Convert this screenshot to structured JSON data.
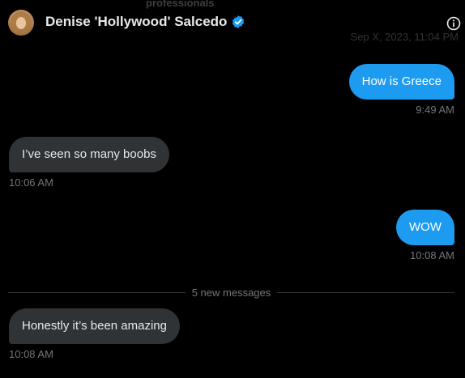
{
  "header": {
    "contact_name": "Denise 'Hollywood' Salcedo",
    "ghost_text": "professionals",
    "ghost_date": "Sep X, 2023, 11:04 PM",
    "icons": {
      "avatar": "avatar",
      "verified": "verified-badge-icon",
      "info": "info-icon"
    }
  },
  "messages": [
    {
      "direction": "out",
      "text": "How is Greece",
      "time": "9:49 AM"
    },
    {
      "direction": "in",
      "text": "I’ve seen so many boobs",
      "time": "10:06 AM"
    },
    {
      "direction": "out",
      "text": "WOW",
      "time": "10:08 AM"
    },
    {
      "direction": "in",
      "text": "Honestly it’s been amazing",
      "time": "10:08 AM"
    }
  ],
  "divider": {
    "label": "5 new messages"
  },
  "colors": {
    "background": "#000000",
    "outgoing_bubble": "#1d9bf0",
    "incoming_bubble": "#2f3336",
    "timestamp": "#71767b",
    "verified": "#1d9bf0"
  }
}
